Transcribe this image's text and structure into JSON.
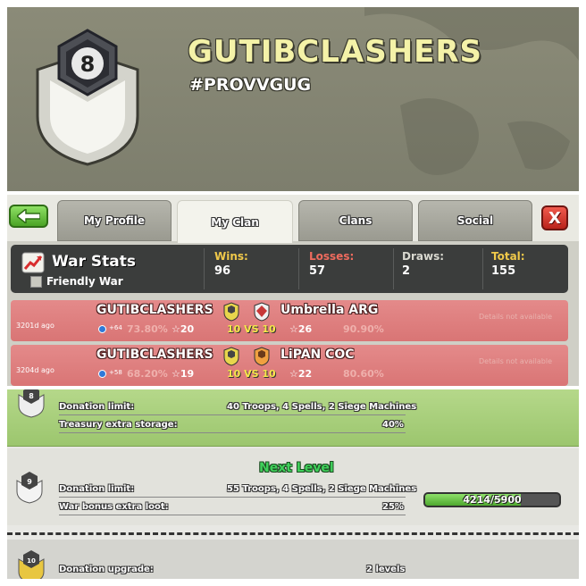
{
  "clan": {
    "level": "8",
    "name": "GUTIBCLASHERS",
    "tag": "#PROVVGUG"
  },
  "tabs": [
    {
      "label": "My Profile"
    },
    {
      "label": "My Clan"
    },
    {
      "label": "Clans"
    },
    {
      "label": "Social"
    }
  ],
  "close_label": "X",
  "war_stats": {
    "title": "War Stats",
    "friendly_label": "Friendly War",
    "wins_label": "Wins:",
    "wins": "96",
    "losses_label": "Losses:",
    "losses": "57",
    "draws_label": "Draws:",
    "draws": "2",
    "total_label": "Total:",
    "total": "155",
    "colors": {
      "wins": "#f0c94a",
      "losses": "#ef6b5e",
      "draws": "#d9d9d0",
      "total": "#f0c94a"
    }
  },
  "wars": [
    {
      "ago": "3201d ago",
      "home": "GUTIBCLASHERS",
      "away": "Umbrella ARG",
      "xp": "+64",
      "home_pct": "73.80%",
      "home_stars": "20",
      "vs": "10 VS 10",
      "away_stars": "26",
      "away_pct": "90.90%",
      "details": "Details not available"
    },
    {
      "ago": "3204d ago",
      "home": "GUTIBCLASHERS",
      "away": "LiPAN COC",
      "xp": "+58",
      "home_pct": "68.20%",
      "home_stars": "19",
      "vs": "10 VS 10",
      "away_stars": "22",
      "away_pct": "80.60%",
      "details": "Details not available"
    }
  ],
  "perks": {
    "current": {
      "badge": "8",
      "donation_label": "Donation limit:",
      "donation_value": "40 Troops, 4 Spells, 2 Siege Machines",
      "treasury_label": "Treasury extra storage:",
      "treasury_value": "40%"
    },
    "next": {
      "heading": "Next Level",
      "badge": "9",
      "donation_label": "Donation limit:",
      "donation_value": "55 Troops, 4 Spells, 2 Siege Machines",
      "war_label": "War bonus extra loot:",
      "war_value": "25%",
      "progress_text": "4214/5900",
      "progress_fraction": 0.714
    },
    "upgrade": {
      "badge": "10",
      "label": "Donation upgrade:",
      "value": "2 levels"
    }
  }
}
